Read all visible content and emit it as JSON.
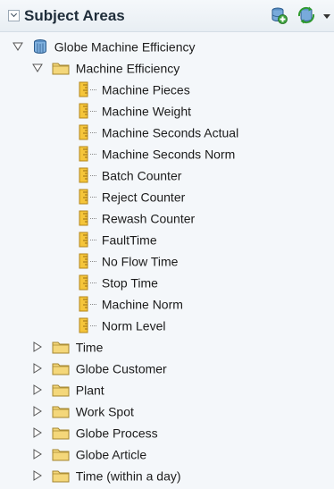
{
  "header": {
    "title": "Subject Areas",
    "icons": [
      "add-subject-area-icon",
      "refresh-icon"
    ]
  },
  "tree": {
    "root": {
      "label": "Globe Machine Efficiency",
      "expanded": true
    },
    "folders": [
      {
        "label": "Machine Efficiency",
        "expanded": true,
        "columns": [
          "Machine Pieces",
          "Machine Weight",
          "Machine Seconds Actual",
          "Machine Seconds Norm",
          "Batch Counter",
          "Reject Counter",
          "Rewash Counter",
          "FaultTime",
          "No Flow Time",
          "Stop Time",
          "Machine Norm",
          "Norm Level"
        ]
      },
      {
        "label": "Time",
        "expanded": false
      },
      {
        "label": "Globe Customer",
        "expanded": false
      },
      {
        "label": "Plant",
        "expanded": false
      },
      {
        "label": "Work Spot",
        "expanded": false
      },
      {
        "label": "Globe Process",
        "expanded": false
      },
      {
        "label": "Globe Article",
        "expanded": false
      },
      {
        "label": "Time (within a day)",
        "expanded": false
      }
    ]
  }
}
